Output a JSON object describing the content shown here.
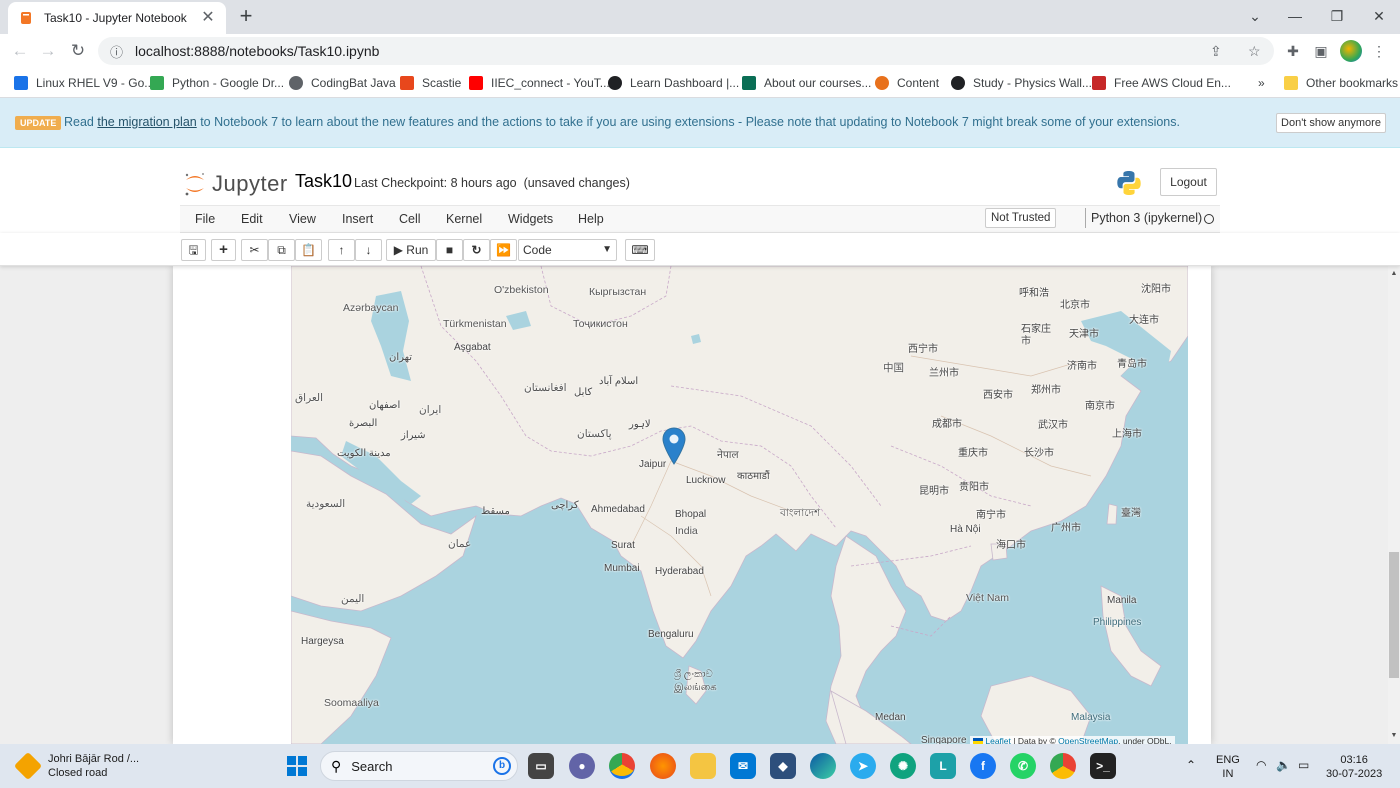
{
  "browser": {
    "tab_title": "Task10 - Jupyter Notebook",
    "tab_close": "✕",
    "new_tab": "+",
    "url": "localhost:8888/notebooks/Task10.ipynb",
    "bookmarks": [
      {
        "label": "Linux RHEL V9 - Go...",
        "color": "#1a73e8"
      },
      {
        "label": "Python - Google Dr...",
        "color": "#34a853"
      },
      {
        "label": "CodingBat Java",
        "color": "#5f6368"
      },
      {
        "label": "Scastie",
        "color": "#e8471c"
      },
      {
        "label": "IIEC_connect - YouT...",
        "color": "#ff0000"
      },
      {
        "label": "Learn Dashboard |...",
        "color": "#202124"
      },
      {
        "label": "About our courses...",
        "color": "#0a6e55"
      },
      {
        "label": "Content",
        "color": "#e8711c"
      },
      {
        "label": "Study - Physics Wall...",
        "color": "#202124"
      },
      {
        "label": "Free AWS Cloud En...",
        "color": "#c62828"
      }
    ],
    "more_bookmarks": "»",
    "other_bookmarks": "Other bookmarks"
  },
  "banner": {
    "badge": "UPDATE",
    "text_before": "Read ",
    "link": "the migration plan",
    "text_after": " to Notebook 7 to learn about the new features and the actions to take if you are using extensions - Please note that updating to Notebook 7 might break some of your extensions.",
    "dismiss": "Don't show anymore"
  },
  "header": {
    "logo_text": "Jupyter",
    "notebook_name": "Task10",
    "checkpoint": "Last Checkpoint: 8 hours ago",
    "unsaved": "(unsaved changes)",
    "logout": "Logout"
  },
  "menu": {
    "items": [
      "File",
      "Edit",
      "View",
      "Insert",
      "Cell",
      "Kernel",
      "Widgets",
      "Help"
    ],
    "trust": "Not Trusted",
    "kernel": "Python 3 (ipykernel)"
  },
  "toolbar": {
    "run_label": "Run",
    "cell_type": "Code"
  },
  "map": {
    "labels": [
      {
        "text": "O'zbekiston",
        "cls": "big"
      },
      {
        "text": "Кыргызстан",
        "cls": "big"
      },
      {
        "text": "Azərbaycan",
        "cls": "big"
      },
      {
        "text": "Türkmenistan",
        "cls": "big"
      },
      {
        "text": "Тоҷикистон",
        "cls": "big"
      },
      {
        "text": "Aşgabat",
        "cls": ""
      },
      {
        "text": "تهران",
        "cls": ""
      },
      {
        "text": "ایران",
        "cls": "big"
      },
      {
        "text": "اصفهان",
        "cls": ""
      },
      {
        "text": "شیراز",
        "cls": ""
      },
      {
        "text": "العراق",
        "cls": "big"
      },
      {
        "text": "البصرة",
        "cls": ""
      },
      {
        "text": "مدينة الكويت",
        "cls": ""
      },
      {
        "text": "افغانستان",
        "cls": "big"
      },
      {
        "text": "كابل",
        "cls": ""
      },
      {
        "text": "اسلام آباد",
        "cls": ""
      },
      {
        "text": "لاہور",
        "cls": ""
      },
      {
        "text": "پاکستان",
        "cls": "big"
      },
      {
        "text": "كراچى",
        "cls": ""
      },
      {
        "text": "Jaipur",
        "cls": ""
      },
      {
        "text": "Lucknow",
        "cls": ""
      },
      {
        "text": "नेपाल",
        "cls": "big"
      },
      {
        "text": "काठमाडौं",
        "cls": ""
      },
      {
        "text": "Ahmedabad",
        "cls": ""
      },
      {
        "text": "Bhopal",
        "cls": ""
      },
      {
        "text": "India",
        "cls": "big"
      },
      {
        "text": "Surat",
        "cls": ""
      },
      {
        "text": "Mumbai",
        "cls": ""
      },
      {
        "text": "Hyderabad",
        "cls": ""
      },
      {
        "text": "Bengaluru",
        "cls": ""
      },
      {
        "text": "ශ්‍රී ලංකාව இலங்கை",
        "cls": ""
      },
      {
        "text": "বাংলাদেশ",
        "cls": "big"
      },
      {
        "text": "中国",
        "cls": "big"
      },
      {
        "text": "呼和浩",
        "cls": ""
      },
      {
        "text": "北京市",
        "cls": ""
      },
      {
        "text": "天津市",
        "cls": ""
      },
      {
        "text": "石家庄市",
        "cls": ""
      },
      {
        "text": "西宁市",
        "cls": ""
      },
      {
        "text": "兰州市",
        "cls": ""
      },
      {
        "text": "西安市",
        "cls": ""
      },
      {
        "text": "郑州市",
        "cls": ""
      },
      {
        "text": "济南市",
        "cls": ""
      },
      {
        "text": "青岛市",
        "cls": ""
      },
      {
        "text": "成都市",
        "cls": ""
      },
      {
        "text": "重庆市",
        "cls": ""
      },
      {
        "text": "武汉市",
        "cls": ""
      },
      {
        "text": "长沙市",
        "cls": ""
      },
      {
        "text": "上海市",
        "cls": ""
      },
      {
        "text": "南京市",
        "cls": ""
      },
      {
        "text": "广州市",
        "cls": ""
      },
      {
        "text": "昆明市",
        "cls": ""
      },
      {
        "text": "贵阳市",
        "cls": ""
      },
      {
        "text": "南宁市",
        "cls": ""
      },
      {
        "text": "Hà Nội",
        "cls": ""
      },
      {
        "text": "海口市",
        "cls": ""
      },
      {
        "text": "Việt Nam",
        "cls": "big"
      },
      {
        "text": "Manila",
        "cls": ""
      },
      {
        "text": "Philippines",
        "cls": "sea"
      },
      {
        "text": "Malaysia",
        "cls": "sea"
      },
      {
        "text": "Medan",
        "cls": ""
      },
      {
        "text": "Singapore",
        "cls": ""
      },
      {
        "text": "Hargeysa",
        "cls": ""
      },
      {
        "text": "Soomaaliya",
        "cls": "big"
      },
      {
        "text": "عمان",
        "cls": "big"
      },
      {
        "text": "مسقط",
        "cls": ""
      },
      {
        "text": "السعودية",
        "cls": "big"
      },
      {
        "text": "اليمن",
        "cls": "big"
      },
      {
        "text": "臺灣",
        "cls": ""
      },
      {
        "text": "大连市",
        "cls": ""
      },
      {
        "text": "沈阳市",
        "cls": ""
      }
    ],
    "attribution_leaflet": "Leaflet",
    "attribution_text": " | Data by © ",
    "attribution_osm": "OpenStreetMap",
    "attribution_tail": ", under ODbL."
  },
  "taskbar": {
    "weather_title": "Johri Bājār Rod /...",
    "weather_sub": "Closed road",
    "search": "Search",
    "lang1": "ENG",
    "lang2": "IN",
    "time": "03:16",
    "date": "30-07-2023"
  }
}
